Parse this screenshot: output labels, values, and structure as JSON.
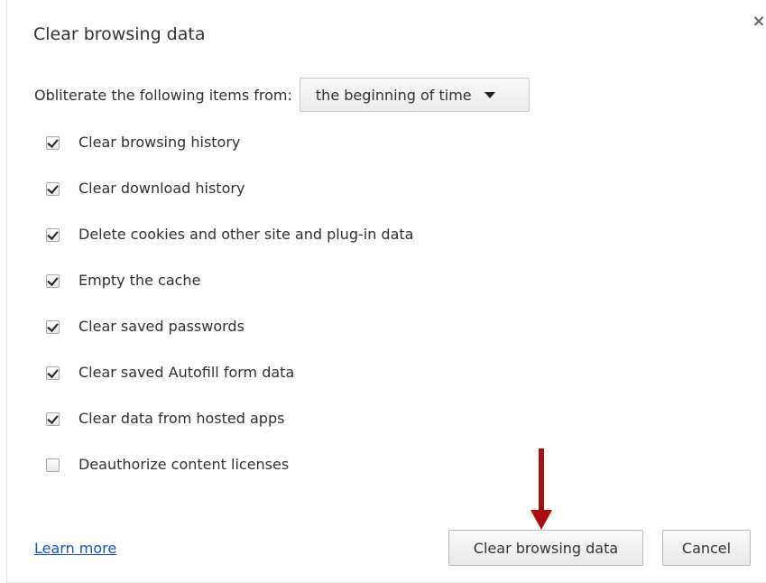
{
  "dialog": {
    "title": "Clear browsing data",
    "close_icon": "close-icon",
    "close_symbol": "×"
  },
  "time_range": {
    "label": "Obliterate the following items from:",
    "selected": "the beginning of time"
  },
  "options": [
    {
      "label": "Clear browsing history",
      "checked": true
    },
    {
      "label": "Clear download history",
      "checked": true
    },
    {
      "label": "Delete cookies and other site and plug-in data",
      "checked": true
    },
    {
      "label": "Empty the cache",
      "checked": true
    },
    {
      "label": "Clear saved passwords",
      "checked": true
    },
    {
      "label": "Clear saved Autofill form data",
      "checked": true
    },
    {
      "label": "Clear data from hosted apps",
      "checked": true
    },
    {
      "label": "Deauthorize content licenses",
      "checked": false
    }
  ],
  "footer": {
    "learn_more": "Learn more",
    "clear_button": "Clear browsing data",
    "cancel_button": "Cancel"
  },
  "colors": {
    "link": "#1155cc",
    "annotation_arrow": "#a80f0f"
  }
}
